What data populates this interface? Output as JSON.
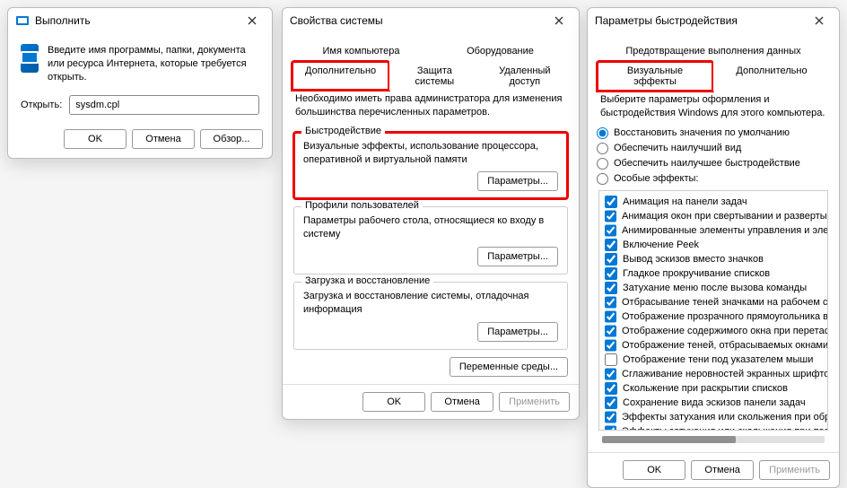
{
  "run": {
    "title": "Выполнить",
    "description": "Введите имя программы, папки, документа или ресурса Интернета, которые требуется открыть.",
    "open_label": "Открыть:",
    "value": "sysdm.cpl",
    "ok": "OK",
    "cancel": "Отмена",
    "browse": "Обзор..."
  },
  "sysprops": {
    "title": "Свойства системы",
    "tabs_top": [
      "Имя компьютера",
      "Оборудование"
    ],
    "tabs_bottom": [
      "Дополнительно",
      "Защита системы",
      "Удаленный доступ"
    ],
    "admin_note": "Необходимо иметь права администратора для изменения большинства перечисленных параметров.",
    "perf_legend": "Быстродействие",
    "perf_desc": "Визуальные эффекты, использование процессора, оперативной и виртуальной памяти",
    "params_btn": "Параметры...",
    "profiles_legend": "Профили пользователей",
    "profiles_desc": "Параметры рабочего стола, относящиеся ко входу в систему",
    "startup_legend": "Загрузка и восстановление",
    "startup_desc": "Загрузка и восстановление системы, отладочная информация",
    "env_btn": "Переменные среды...",
    "ok": "OK",
    "cancel": "Отмена",
    "apply": "Применить"
  },
  "perf": {
    "title": "Параметры быстродействия",
    "tabs": [
      "Визуальные эффекты",
      "Дополнительно"
    ],
    "tabs_top": "Предотвращение выполнения данных",
    "intro": "Выберите параметры оформления и быстродействия Windows для этого компьютера.",
    "radios": [
      "Восстановить значения по умолчанию",
      "Обеспечить наилучший вид",
      "Обеспечить наилучшее быстродействие",
      "Особые эффекты:"
    ],
    "radio_selected": 0,
    "checks": [
      {
        "c": true,
        "t": "Анимация на панели задач"
      },
      {
        "c": true,
        "t": "Анимация окон при свертывании и развертывании"
      },
      {
        "c": true,
        "t": "Анимированные элементы управления и элементы внут"
      },
      {
        "c": true,
        "t": "Включение Peek"
      },
      {
        "c": true,
        "t": "Вывод эскизов вместо значков"
      },
      {
        "c": true,
        "t": "Гладкое прокручивание списков"
      },
      {
        "c": true,
        "t": "Затухание меню после вызова команды"
      },
      {
        "c": true,
        "t": "Отбрасывание теней значками на рабочем столе"
      },
      {
        "c": true,
        "t": "Отображение прозрачного прямоугольника выделения"
      },
      {
        "c": true,
        "t": "Отображение содержимого окна при перетаскивании"
      },
      {
        "c": true,
        "t": "Отображение теней, отбрасываемых окнами"
      },
      {
        "c": false,
        "t": "Отображение тени под указателем мыши"
      },
      {
        "c": true,
        "t": "Сглаживание неровностей экранных шрифтов"
      },
      {
        "c": true,
        "t": "Скольжение при раскрытии списков"
      },
      {
        "c": true,
        "t": "Сохранение вида эскизов панели задач"
      },
      {
        "c": true,
        "t": "Эффекты затухания или скольжения при обращении к ме"
      },
      {
        "c": true,
        "t": "Эффекты затухания или скольжения при появлении подс"
      }
    ],
    "ok": "OK",
    "cancel": "Отмена",
    "apply": "Применить"
  }
}
